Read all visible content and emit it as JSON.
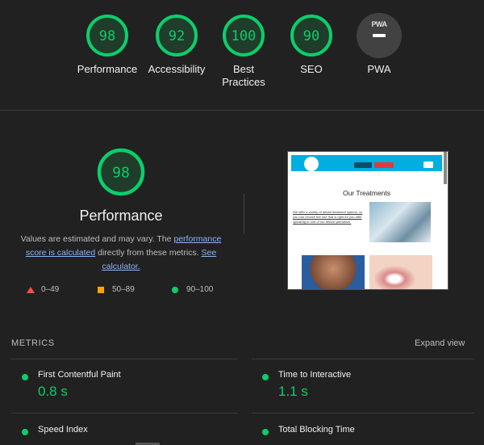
{
  "summary": {
    "gauges": [
      {
        "score": "98",
        "label": "Performance"
      },
      {
        "score": "92",
        "label": "Accessibility"
      },
      {
        "score": "100",
        "label": "Best Practices"
      },
      {
        "score": "90",
        "label": "SEO"
      }
    ],
    "pwa": {
      "badge_text": "PWA",
      "label": "PWA"
    }
  },
  "performance": {
    "score": "98",
    "title": "Performance",
    "desc_prefix": "Values are estimated and may vary. The ",
    "desc_link1": "performance score is calculated",
    "desc_middle": " directly from these metrics. ",
    "desc_link2": "See calculator.",
    "legend": {
      "fail": "0–49",
      "average": "50–89",
      "pass": "90–100"
    }
  },
  "preview": {
    "heading": "Our Treatments",
    "paragraph": "We offer a variety of dental treatment options, so you can choose the one that is right for you after speaking to one of our dental specialists."
  },
  "metrics": {
    "section_title": "METRICS",
    "expand_label": "Expand view",
    "items": [
      {
        "name": "First Contentful Paint",
        "value": "0.8 s"
      },
      {
        "name": "Time to Interactive",
        "value": "1.1 s"
      },
      {
        "name": "Speed Index",
        "value": ""
      },
      {
        "name": "Total Blocking Time",
        "value": ""
      }
    ]
  },
  "colors": {
    "pass": "#0cce6b",
    "average": "#ffa400",
    "fail": "#ff4e42",
    "link": "#8ab4f8",
    "background": "#212121"
  }
}
